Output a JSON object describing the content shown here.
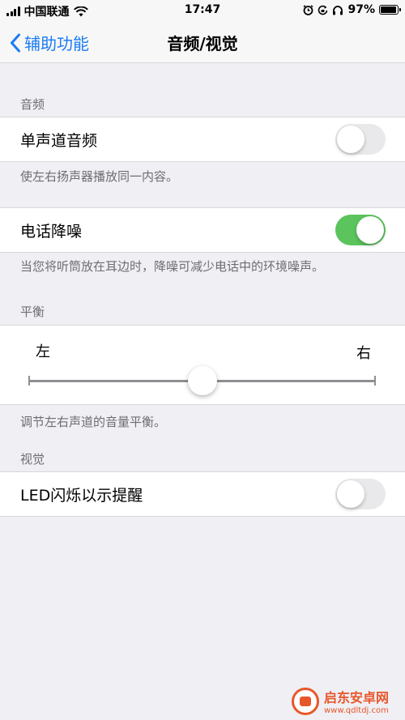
{
  "status_bar": {
    "carrier": "中国联通",
    "time": "17:47",
    "battery": "97%",
    "icons": [
      "signal-icon",
      "wifi-icon",
      "alarm-icon",
      "lock-rotation-icon",
      "headphones-icon",
      "battery-icon"
    ]
  },
  "nav": {
    "back_label": "辅助功能",
    "title": "音频/视觉"
  },
  "audio": {
    "header": "音频",
    "mono_label": "单声道音频",
    "mono_on": false,
    "mono_footer": "使左右扬声器播放同一内容。",
    "noise_label": "电话降噪",
    "noise_on": true,
    "noise_footer": "当您将听筒放在耳边时，降噪可减少电话中的环境噪声。"
  },
  "balance": {
    "header": "平衡",
    "left_label": "左",
    "right_label": "右",
    "value": 0.5,
    "footer": "调节左右声道的音量平衡。"
  },
  "visual": {
    "header": "视觉",
    "led_label": "LED闪烁以示提醒",
    "led_on": false
  },
  "watermark": {
    "name": "启东安卓网",
    "url": "www.qdltdj.com"
  },
  "colors": {
    "accent": "#1a7cf4",
    "toggle_on": "#5bc45c",
    "background": "#efeff4"
  }
}
